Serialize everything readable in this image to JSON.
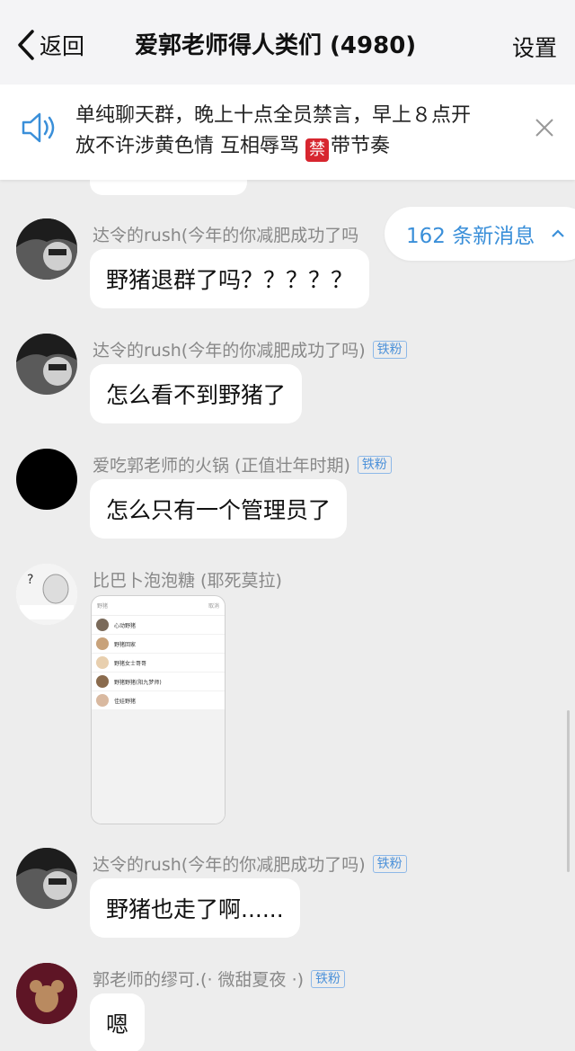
{
  "header": {
    "back_label": "返回",
    "title": "爱郭老师得人类们 (4980)",
    "settings_label": "设置"
  },
  "notice": {
    "line1": "单纯聊天群，晚上十点全员禁言，早上８点开",
    "line2_a": "放不许涉黄色情 互相辱骂 ",
    "ban_char": "禁",
    "line2_b": "带节奏"
  },
  "new_messages": {
    "label": "162 条新消息"
  },
  "messages": [
    {
      "sender": "达令的rush(今年的你减肥成功了吗",
      "badge": "",
      "text": "野猪退群了吗？？？？？"
    },
    {
      "sender": "达令的rush(今年的你减肥成功了吗)",
      "badge": "铁粉",
      "text": "怎么看不到野猪了"
    },
    {
      "sender": "爱吃郭老师的火锅 (正值壮年时期)",
      "badge": "铁粉",
      "text": "怎么只有一个管理员了"
    },
    {
      "sender": "比巴卜泡泡糖 (耶死莫拉)",
      "badge": "",
      "text": ""
    },
    {
      "sender": "达令的rush(今年的你减肥成功了吗)",
      "badge": "铁粉",
      "text": "野猪也走了啊......"
    },
    {
      "sender": "郭老师的缪可.(· 微甜夏夜 ·)",
      "badge": "铁粉",
      "text": "嗯"
    }
  ],
  "screenshot_image": {
    "search_text": "野猪",
    "cancel_text": "取消",
    "results": [
      "心动野猪",
      "野猪回家",
      "野猪女士哥哥",
      "野猪野猪(阳九梦师)",
      "佳娃野猪"
    ]
  },
  "colors": {
    "accent_blue": "#3a8fd9",
    "ban_red": "#d7262f",
    "background": "#ededed"
  }
}
